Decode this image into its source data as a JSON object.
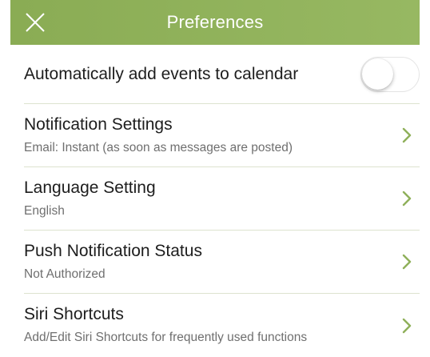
{
  "header": {
    "title": "Preferences",
    "close_icon": "close-icon",
    "bg_color": "#8fb05a"
  },
  "rows": [
    {
      "title": "Automatically add events to calendar",
      "control": "toggle",
      "toggle_on": false
    },
    {
      "title": "Notification Settings",
      "subtitle": "Email: Instant (as soon as messages are posted)",
      "icon": "chevron-right-icon"
    },
    {
      "title": "Language Setting",
      "subtitle": "English",
      "icon": "chevron-right-icon"
    },
    {
      "title": "Push Notification Status",
      "subtitle": "Not Authorized",
      "icon": "chevron-right-icon"
    },
    {
      "title": "Siri Shortcuts",
      "subtitle": "Add/Edit Siri Shortcuts for frequently used functions",
      "icon": "chevron-right-icon"
    }
  ],
  "colors": {
    "accent": "#8fb05a",
    "separator": "#dde3cf",
    "subtitle": "#6f6f6f"
  }
}
